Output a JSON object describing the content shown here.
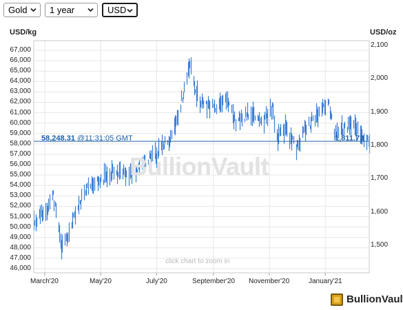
{
  "toolbar": {
    "metal": "Gold",
    "period": "1 year",
    "currency": "USD"
  },
  "chart": {
    "left_unit": "USD/kg",
    "right_unit": "USD/oz",
    "price_value": "58,248.31",
    "price_time": "@11:31:05 GMT",
    "price_oz": "1,811.73",
    "watermark": "BullionVault",
    "zoom_hint": "click chart to zoom in"
  },
  "brand": {
    "name": "BullionVault"
  },
  "colors": {
    "series": "#3b7fd4",
    "price_line": "#1a5fa8",
    "grid": "#e4e4e4",
    "logo_gold": "#d9a21b"
  },
  "chart_data": {
    "type": "line",
    "style": "OHLC-style vertical daily ranges",
    "y_left": {
      "label": "USD/kg",
      "ticks": [
        "46,000",
        "47,000",
        "48,000",
        "49,000",
        "50,000",
        "51,000",
        "52,000",
        "53,000",
        "54,000",
        "55,000",
        "56,000",
        "57,000",
        "58,000",
        "59,000",
        "60,000",
        "61,000",
        "62,000",
        "63,000",
        "64,000",
        "65,000",
        "66,000",
        "67,000"
      ],
      "range": [
        45500,
        67500
      ]
    },
    "y_right": {
      "label": "USD/oz",
      "ticks": [
        "1,500",
        "1,600",
        "1,700",
        "1,800",
        "1,900",
        "2,000",
        "2,100"
      ],
      "range": [
        1415,
        2100
      ]
    },
    "x_ticks": [
      "March'20",
      "May'20",
      "July'20",
      "September'20",
      "November'20",
      "January'21"
    ],
    "x_range": [
      "2020-02-18",
      "2021-02-18"
    ],
    "current_price_kg": 58248.31,
    "current_price_oz": 1811.73,
    "series": {
      "x": [
        "2020-02-18",
        "2020-03-01",
        "2020-03-10",
        "2020-03-19",
        "2020-03-25",
        "2020-04-06",
        "2020-04-15",
        "2020-05-01",
        "2020-05-15",
        "2020-06-01",
        "2020-06-15",
        "2020-06-30",
        "2020-07-15",
        "2020-07-24",
        "2020-07-31",
        "2020-08-06",
        "2020-08-12",
        "2020-08-18",
        "2020-08-31",
        "2020-09-15",
        "2020-09-25",
        "2020-10-10",
        "2020-10-25",
        "2020-11-04",
        "2020-11-09",
        "2020-11-18",
        "2020-11-30",
        "2020-12-10",
        "2020-12-20",
        "2021-01-05",
        "2021-01-10",
        "2021-01-20",
        "2021-02-01",
        "2021-02-10",
        "2021-02-18"
      ],
      "y": [
        50500,
        51500,
        53000,
        48000,
        49000,
        52000,
        53500,
        54500,
        55500,
        55000,
        56000,
        57000,
        58500,
        60500,
        63500,
        65500,
        63000,
        62000,
        61500,
        62500,
        60000,
        61000,
        60000,
        61500,
        58500,
        59500,
        57500,
        59500,
        60500,
        62000,
        59000,
        59500,
        59800,
        58700,
        58248
      ]
    },
    "grid": true,
    "legend": "none"
  }
}
